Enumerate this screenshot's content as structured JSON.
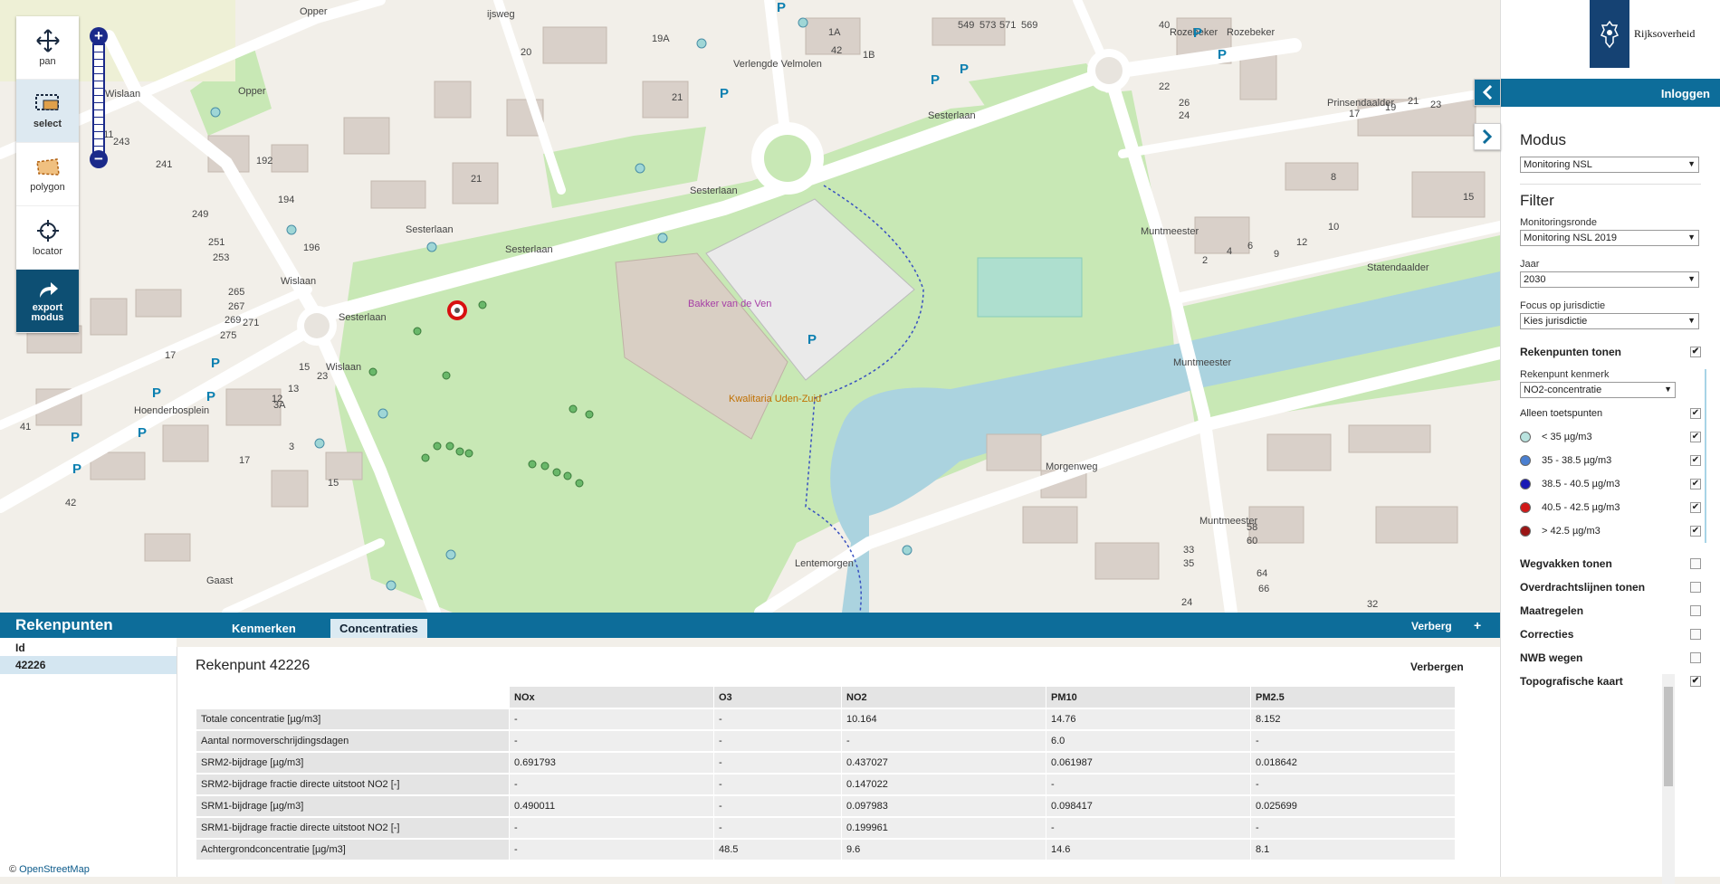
{
  "tools": [
    {
      "label": "pan",
      "icon": "move-arrows-icon"
    },
    {
      "label": "select",
      "icon": "select-rectangle-icon"
    },
    {
      "label": "polygon",
      "icon": "polygon-icon"
    },
    {
      "label": "locator",
      "icon": "crosshair-icon"
    },
    {
      "label": "export modus",
      "icon": "share-arrow-icon"
    }
  ],
  "zoom": {
    "plus": "+",
    "minus": "−"
  },
  "map": {
    "streets": [
      "Opper",
      "Wislaan",
      "Opper",
      "Sesterlaan",
      "Sesterlaan",
      "Sesterlaan",
      "Sesterlaan",
      "Sesterlaan",
      "Verlengde Velmolen",
      "Muntmeester",
      "Muntmeester",
      "Muntmeester",
      "Statendaalder",
      "Morgenweg",
      "Lentemorgen",
      "Hoenderbosplein",
      "Wislaan",
      "Wislaan",
      "Gaast",
      "Prinsendaalder",
      "Rozebeker",
      "Rozebeker",
      "ijsweg"
    ],
    "poi": [
      "Bakker van de Ven",
      "Kwalitaria Uden-Zuid"
    ],
    "parking": "P",
    "house_numbers": [
      "19A",
      "1A",
      "42",
      "1B",
      "549",
      "573",
      "571",
      "569",
      "20",
      "21",
      "21",
      "192",
      "194",
      "196",
      "249",
      "251",
      "253",
      "265",
      "267",
      "269",
      "271",
      "275",
      "211",
      "243",
      "241",
      "17",
      "17",
      "15",
      "23",
      "41",
      "42",
      "3",
      "12",
      "13",
      "3A",
      "15",
      "40",
      "26",
      "24",
      "22",
      "33",
      "35",
      "58",
      "60",
      "64",
      "66",
      "24",
      "32",
      "10",
      "12",
      "9",
      "2",
      "4",
      "6",
      "8",
      "15",
      "17",
      "19",
      "21",
      "23"
    ],
    "attribution": "OpenStreetMap",
    "attribution_prefix": "© "
  },
  "panel": {
    "logo_text": "Rijksoverheid",
    "login": "Inloggen",
    "modus_heading": "Modus",
    "modus_value": "Monitoring NSL",
    "filter_heading": "Filter",
    "monitoringsronde_label": "Monitoringsronde",
    "monitoringsronde_value": "Monitoring NSL 2019",
    "jaar_label": "Jaar",
    "jaar_value": "2030",
    "focus_label": "Focus op jurisdictie",
    "focus_value": "Kies jurisdictie",
    "rekenpunten_tonen": "Rekenpunten tonen",
    "rekenpunt_kenmerk_label": "Rekenpunt kenmerk",
    "rekenpunt_kenmerk_value": "NO2-concentratie",
    "alleen_toetspunten": "Alleen toetspunten",
    "legend": [
      {
        "label": "< 35 µg/m3",
        "color": "#b9e3df"
      },
      {
        "label": "35 - 38.5 µg/m3",
        "color": "#4a7fd0"
      },
      {
        "label": "38.5 - 40.5 µg/m3",
        "color": "#1a1ab5"
      },
      {
        "label": "40.5 - 42.5 µg/m3",
        "color": "#d11818"
      },
      {
        "label": "> 42.5 µg/m3",
        "color": "#9b1515"
      }
    ],
    "layers": [
      {
        "label": "Wegvakken tonen",
        "checked": false
      },
      {
        "label": "Overdrachtslijnen tonen",
        "checked": false
      },
      {
        "label": "Maatregelen",
        "checked": false
      },
      {
        "label": "Correcties",
        "checked": false
      },
      {
        "label": "NWB wegen",
        "checked": false
      },
      {
        "label": "Topografische kaart",
        "checked": true
      }
    ],
    "check_mark": "✔"
  },
  "bottom": {
    "title": "Rekenpunten",
    "tabs": [
      "Kenmerken",
      "Concentraties"
    ],
    "verberg": "Verberg",
    "plus": "+",
    "id_header": "Id",
    "id_value": "42226",
    "detail_title": "Rekenpunt 42226",
    "verbergen": "Verbergen",
    "columns": [
      "NOx",
      "O3",
      "NO2",
      "PM10",
      "PM2.5"
    ],
    "rows": [
      [
        "Totale concentratie [µg/m3]",
        "-",
        "-",
        "10.164",
        "14.76",
        "8.152"
      ],
      [
        "Aantal normoverschrijdingsdagen",
        "-",
        "-",
        "-",
        "6.0",
        "-"
      ],
      [
        "SRM2-bijdrage [µg/m3]",
        "0.691793",
        "-",
        "0.437027",
        "0.061987",
        "0.018642"
      ],
      [
        "SRM2-bijdrage fractie directe uitstoot NO2 [-]",
        "-",
        "-",
        "0.147022",
        "-",
        "-"
      ],
      [
        "SRM1-bijdrage [µg/m3]",
        "0.490011",
        "-",
        "0.097983",
        "0.098417",
        "0.025699"
      ],
      [
        "SRM1-bijdrage fractie directe uitstoot NO2 [-]",
        "-",
        "-",
        "0.199961",
        "-",
        "-"
      ],
      [
        "Achtergrondconcentratie [µg/m3]",
        "-",
        "48.5",
        "9.6",
        "14.6",
        "8.1"
      ]
    ]
  },
  "colors": {
    "brand": "#0d6d9a",
    "rijks": "#154273",
    "park": "#c8e8b5",
    "water": "#abd3df",
    "road": "#ffffff"
  }
}
